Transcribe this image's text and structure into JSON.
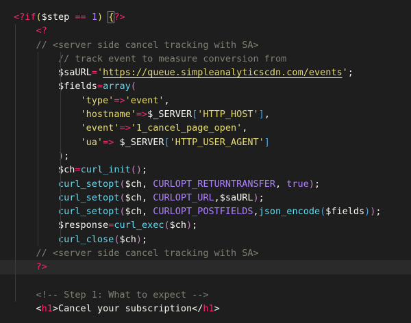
{
  "lines": [
    {
      "indent": 0,
      "tokens": [
        {
          "t": "<?if",
          "c": "kw"
        },
        {
          "t": "(",
          "c": "br"
        },
        {
          "t": "$step",
          "c": "var"
        },
        {
          "t": " == ",
          "c": "kw"
        },
        {
          "t": "1",
          "c": "num"
        },
        {
          "t": ")",
          "c": "br"
        },
        {
          "t": " ",
          "c": "pun"
        },
        {
          "t": "{",
          "c": "br boxed"
        },
        {
          "t": "?>",
          "c": "kw"
        }
      ]
    },
    {
      "indent": 1,
      "tokens": [
        {
          "t": "<?",
          "c": "kw"
        }
      ]
    },
    {
      "indent": 1,
      "tokens": [
        {
          "t": "// <server side cancel tracking with SA>",
          "c": "cm"
        }
      ]
    },
    {
      "indent": 2,
      "tokens": [
        {
          "t": "// track event to measure conversion from",
          "c": "cm"
        }
      ]
    },
    {
      "indent": 2,
      "tokens": [
        {
          "t": "$saURL",
          "c": "var"
        },
        {
          "t": "=",
          "c": "kw"
        },
        {
          "t": "'",
          "c": "str"
        },
        {
          "t": "https://queue.simpleanalyticscdn.com/events",
          "c": "link"
        },
        {
          "t": "'",
          "c": "str"
        },
        {
          "t": ";",
          "c": "pun"
        }
      ]
    },
    {
      "indent": 2,
      "tokens": [
        {
          "t": "$fields",
          "c": "var"
        },
        {
          "t": "=",
          "c": "kw"
        },
        {
          "t": "array",
          "c": "fn"
        },
        {
          "t": "(",
          "c": "br2"
        }
      ]
    },
    {
      "indent": 3,
      "tokens": [
        {
          "t": "'type'",
          "c": "str"
        },
        {
          "t": "=>",
          "c": "kw"
        },
        {
          "t": "'event'",
          "c": "str"
        },
        {
          "t": ",",
          "c": "pun"
        }
      ]
    },
    {
      "indent": 3,
      "tokens": [
        {
          "t": "'hostname'",
          "c": "str"
        },
        {
          "t": "=>",
          "c": "kw"
        },
        {
          "t": "$_SERVER",
          "c": "var"
        },
        {
          "t": "[",
          "c": "br3"
        },
        {
          "t": "'HTTP_HOST'",
          "c": "str"
        },
        {
          "t": "]",
          "c": "br3"
        },
        {
          "t": ",",
          "c": "pun"
        }
      ]
    },
    {
      "indent": 3,
      "tokens": [
        {
          "t": "'event'",
          "c": "str"
        },
        {
          "t": "=>",
          "c": "kw"
        },
        {
          "t": "'1_cancel_page_open'",
          "c": "str"
        },
        {
          "t": ",",
          "c": "pun"
        }
      ]
    },
    {
      "indent": 3,
      "tokens": [
        {
          "t": "'ua'",
          "c": "str"
        },
        {
          "t": "=>",
          "c": "kw"
        },
        {
          "t": " $_SERVER",
          "c": "var"
        },
        {
          "t": "[",
          "c": "br3"
        },
        {
          "t": "'HTTP_USER_AGENT'",
          "c": "str"
        },
        {
          "t": "]",
          "c": "br3"
        }
      ]
    },
    {
      "indent": 2,
      "tokens": [
        {
          "t": ")",
          "c": "br2"
        },
        {
          "t": ";",
          "c": "pun"
        }
      ]
    },
    {
      "indent": 2,
      "tokens": [
        {
          "t": "$ch",
          "c": "var"
        },
        {
          "t": "=",
          "c": "kw"
        },
        {
          "t": "curl_init",
          "c": "fn"
        },
        {
          "t": "()",
          "c": "br2"
        },
        {
          "t": ";",
          "c": "pun"
        }
      ]
    },
    {
      "indent": 2,
      "tokens": [
        {
          "t": "curl_setopt",
          "c": "fn"
        },
        {
          "t": "(",
          "c": "br2"
        },
        {
          "t": "$ch, ",
          "c": "var"
        },
        {
          "t": "CURLOPT_RETURNTRANSFER",
          "c": "const"
        },
        {
          "t": ", ",
          "c": "pun"
        },
        {
          "t": "true",
          "c": "const"
        },
        {
          "t": ")",
          "c": "br2"
        },
        {
          "t": ";",
          "c": "pun"
        }
      ]
    },
    {
      "indent": 2,
      "tokens": [
        {
          "t": "curl_setopt",
          "c": "fn"
        },
        {
          "t": "(",
          "c": "br2"
        },
        {
          "t": "$ch, ",
          "c": "var"
        },
        {
          "t": "CURLOPT_URL",
          "c": "const"
        },
        {
          "t": ",$saURL",
          "c": "var"
        },
        {
          "t": ")",
          "c": "br2"
        },
        {
          "t": ";",
          "c": "pun"
        }
      ]
    },
    {
      "indent": 2,
      "tokens": [
        {
          "t": "curl_setopt",
          "c": "fn"
        },
        {
          "t": "(",
          "c": "br2"
        },
        {
          "t": "$ch, ",
          "c": "var"
        },
        {
          "t": "CURLOPT_POSTFIELDS",
          "c": "const"
        },
        {
          "t": ",",
          "c": "pun"
        },
        {
          "t": "json_encode",
          "c": "fn"
        },
        {
          "t": "(",
          "c": "br3"
        },
        {
          "t": "$fields",
          "c": "var"
        },
        {
          "t": ")",
          "c": "br3"
        },
        {
          "t": ")",
          "c": "br2"
        },
        {
          "t": ";",
          "c": "pun"
        }
      ]
    },
    {
      "indent": 2,
      "tokens": [
        {
          "t": "$response",
          "c": "var"
        },
        {
          "t": "=",
          "c": "kw"
        },
        {
          "t": "curl_exec",
          "c": "fn"
        },
        {
          "t": "(",
          "c": "br2"
        },
        {
          "t": "$ch",
          "c": "var"
        },
        {
          "t": ")",
          "c": "br2"
        },
        {
          "t": ";",
          "c": "pun"
        }
      ]
    },
    {
      "indent": 2,
      "tokens": [
        {
          "t": "curl_close",
          "c": "fn"
        },
        {
          "t": "(",
          "c": "br2"
        },
        {
          "t": "$ch",
          "c": "var"
        },
        {
          "t": ")",
          "c": "br2"
        },
        {
          "t": ";",
          "c": "pun"
        }
      ]
    },
    {
      "indent": 1,
      "tokens": [
        {
          "t": "// <server side cancel tracking with SA>",
          "c": "cm"
        }
      ]
    },
    {
      "indent": 1,
      "highlight": true,
      "tokens": [
        {
          "t": "?>",
          "c": "kw"
        }
      ]
    },
    {
      "indent": 0,
      "tokens": []
    },
    {
      "indent": 1,
      "tokens": [
        {
          "t": "<!-- Step 1: What to expect -->",
          "c": "cm"
        }
      ]
    },
    {
      "indent": 1,
      "tokens": [
        {
          "t": "<",
          "c": "pun"
        },
        {
          "t": "h1",
          "c": "kw"
        },
        {
          "t": ">Cancel your subscription</",
          "c": "pun"
        },
        {
          "t": "h1",
          "c": "kw"
        },
        {
          "t": ">",
          "c": "pun"
        }
      ]
    }
  ]
}
